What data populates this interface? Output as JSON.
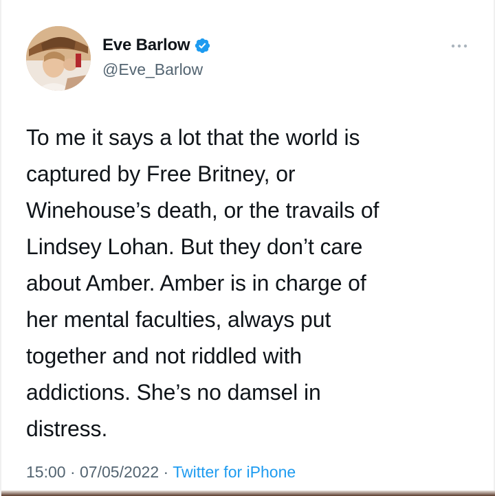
{
  "author": {
    "name": "Eve Barlow",
    "handle": "@Eve_Barlow",
    "verified": true,
    "avatar_icon": "profile-photo-avatar"
  },
  "tweet": {
    "lines": [
      "To me it says a lot that the world is",
      "captured by Free Britney, or",
      "Winehouse’s death, or the travails of",
      "Lindsey Lohan. But they don’t care",
      "about Amber. Amber is in charge of",
      "her mental faculties, always put",
      "together and not riddled with",
      "addictions. She’s no damsel in",
      "distress."
    ],
    "time": "15:00",
    "separator": "·",
    "date": "07/05/2022",
    "source": "Twitter for iPhone"
  },
  "colors": {
    "text": "#0f1419",
    "secondary": "#536471",
    "accent": "#1d9bf0"
  },
  "icons": {
    "more": "more-horizontal-icon",
    "verified": "verified-badge-icon"
  }
}
